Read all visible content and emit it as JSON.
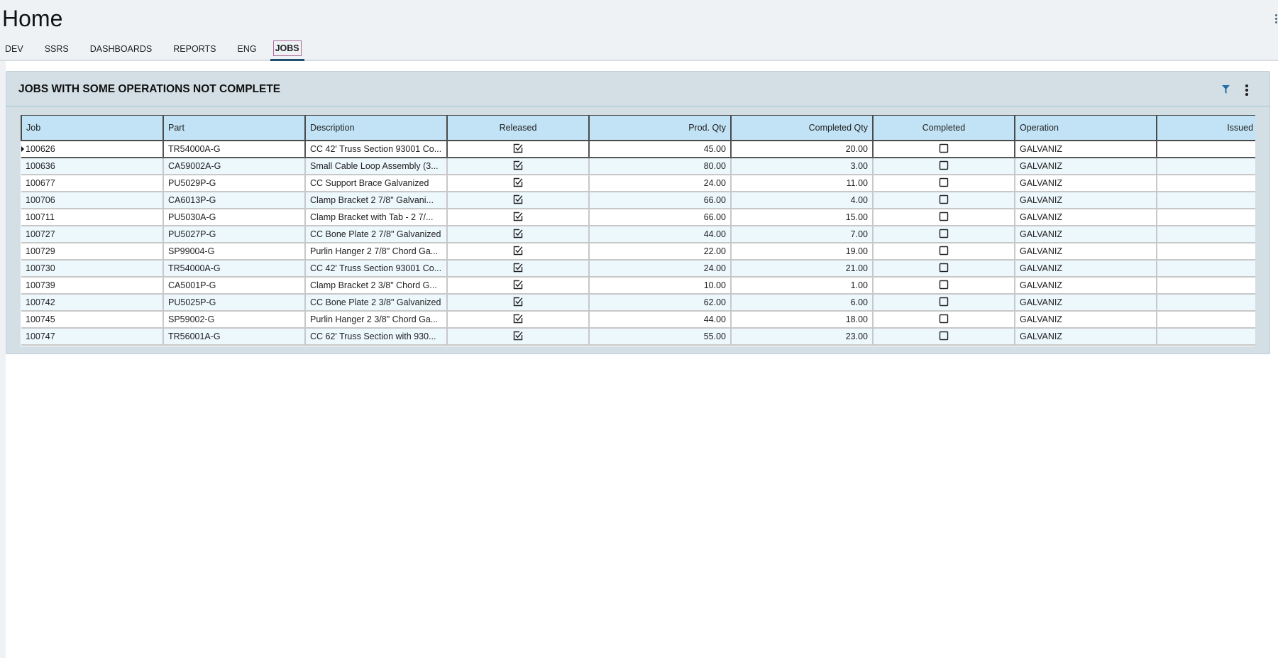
{
  "header": {
    "title": "Home"
  },
  "tabs": [
    {
      "label": "DEV",
      "active": false
    },
    {
      "label": "SSRS",
      "active": false
    },
    {
      "label": "DASHBOARDS",
      "active": false
    },
    {
      "label": "REPORTS",
      "active": false
    },
    {
      "label": "ENG",
      "active": false
    },
    {
      "label": "JOBS",
      "active": true
    }
  ],
  "panel": {
    "title": "JOBS WITH SOME OPERATIONS NOT COMPLETE",
    "icons": [
      "filter-icon",
      "more-vertical-icon"
    ],
    "accent": "#1f6fa5"
  },
  "table": {
    "columns": [
      {
        "label": "Job",
        "align": "left"
      },
      {
        "label": "Part",
        "align": "left"
      },
      {
        "label": "Description",
        "align": "left"
      },
      {
        "label": "Released",
        "align": "center"
      },
      {
        "label": "Prod. Qty",
        "align": "right"
      },
      {
        "label": "Completed Qty",
        "align": "right"
      },
      {
        "label": "Completed",
        "align": "center"
      },
      {
        "label": "Operation",
        "align": "left"
      },
      {
        "label": "Issued Complete",
        "align": "right"
      }
    ],
    "selected_row": 0,
    "rows": [
      {
        "job": "100626",
        "part": "TR54000A-G",
        "description": "CC 42' Truss Section 93001 Co...",
        "released": true,
        "prod_qty": "45.00",
        "completed_qty": "20.00",
        "completed": false,
        "operation": "GALVANIZ",
        "issued_complete": true
      },
      {
        "job": "100636",
        "part": "CA59002A-G",
        "description": "Small Cable Loop Assembly (3...",
        "released": true,
        "prod_qty": "80.00",
        "completed_qty": "3.00",
        "completed": false,
        "operation": "GALVANIZ",
        "issued_complete": true
      },
      {
        "job": "100677",
        "part": "PU5029P-G",
        "description": "CC Support Brace Galvanized",
        "released": true,
        "prod_qty": "24.00",
        "completed_qty": "11.00",
        "completed": false,
        "operation": "GALVANIZ",
        "issued_complete": true
      },
      {
        "job": "100706",
        "part": "CA6013P-G",
        "description": "Clamp Bracket 2 7/8\" Galvani...",
        "released": true,
        "prod_qty": "66.00",
        "completed_qty": "4.00",
        "completed": false,
        "operation": "GALVANIZ",
        "issued_complete": true
      },
      {
        "job": "100711",
        "part": "PU5030A-G",
        "description": "Clamp Bracket with Tab - 2 7/...",
        "released": true,
        "prod_qty": "66.00",
        "completed_qty": "15.00",
        "completed": false,
        "operation": "GALVANIZ",
        "issued_complete": true
      },
      {
        "job": "100727",
        "part": "PU5027P-G",
        "description": "CC Bone Plate 2 7/8\" Galvanized",
        "released": true,
        "prod_qty": "44.00",
        "completed_qty": "7.00",
        "completed": false,
        "operation": "GALVANIZ",
        "issued_complete": true
      },
      {
        "job": "100729",
        "part": "SP99004-G",
        "description": "Purlin Hanger 2 7/8\" Chord Ga...",
        "released": true,
        "prod_qty": "22.00",
        "completed_qty": "19.00",
        "completed": false,
        "operation": "GALVANIZ",
        "issued_complete": true
      },
      {
        "job": "100730",
        "part": "TR54000A-G",
        "description": "CC 42' Truss Section 93001 Co...",
        "released": true,
        "prod_qty": "24.00",
        "completed_qty": "21.00",
        "completed": false,
        "operation": "GALVANIZ",
        "issued_complete": true
      },
      {
        "job": "100739",
        "part": "CA5001P-G",
        "description": "Clamp Bracket 2 3/8\" Chord G...",
        "released": true,
        "prod_qty": "10.00",
        "completed_qty": "1.00",
        "completed": false,
        "operation": "GALVANIZ",
        "issued_complete": true
      },
      {
        "job": "100742",
        "part": "PU5025P-G",
        "description": "CC Bone Plate 2 3/8\" Galvanized",
        "released": true,
        "prod_qty": "62.00",
        "completed_qty": "6.00",
        "completed": false,
        "operation": "GALVANIZ",
        "issued_complete": true
      },
      {
        "job": "100745",
        "part": "SP59002-G",
        "description": "Purlin Hanger 2 3/8\" Chord Ga...",
        "released": true,
        "prod_qty": "44.00",
        "completed_qty": "18.00",
        "completed": false,
        "operation": "GALVANIZ",
        "issued_complete": true
      },
      {
        "job": "100747",
        "part": "TR56001A-G",
        "description": "CC 62' Truss Section with 930...",
        "released": true,
        "prod_qty": "55.00",
        "completed_qty": "23.00",
        "completed": false,
        "operation": "GALVANIZ",
        "issued_complete": true
      }
    ]
  }
}
